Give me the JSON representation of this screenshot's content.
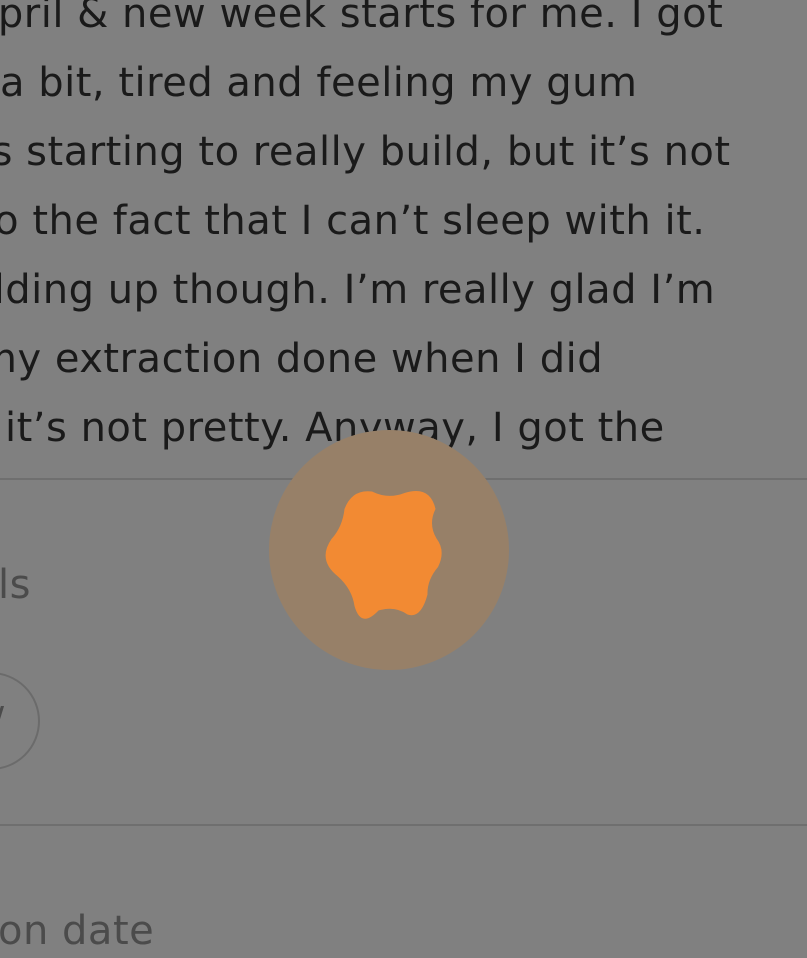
{
  "entry": {
    "lines": [
      "April & new week starts for me. I got",
      "a bit, tired and feeling my gum",
      "is starting to really build, but it’s not",
      "to the fact that I can’t sleep with it.",
      "ilding up though. I’m really glad I’m",
      "my extraction done when I did",
      "it’s not pretty. Anyway, I got the"
    ]
  },
  "sections": {
    "details_label": "ls",
    "chip_text": "/",
    "date_label": "on date"
  },
  "overlay": {
    "icon": "orange-starburst-badge",
    "accent_color": "#F28A33",
    "ring_color": "#978068",
    "scrim_color": "#808080"
  }
}
